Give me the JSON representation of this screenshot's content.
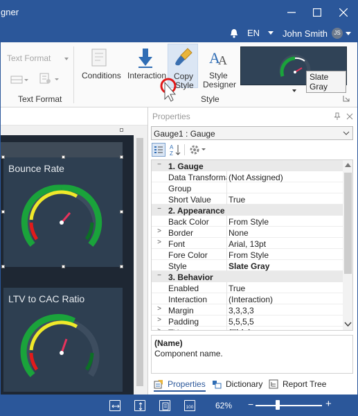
{
  "window": {
    "title": "gner",
    "controls": {
      "minimize": "minimize-icon",
      "maximize": "maximize-icon",
      "close": "close-icon"
    }
  },
  "userbar": {
    "language": "EN",
    "user_name": "John Smith",
    "user_initials": "JS"
  },
  "ribbon": {
    "text_format_dropdown": "Text Format",
    "text_format_group": "Text Format",
    "conditions_label": "Conditions",
    "interaction_label": "Interaction",
    "copy_style_label_1": "Copy",
    "copy_style_label_2": "Style",
    "style_designer_label_1": "Style",
    "style_designer_label_2": "Designer",
    "style_group": "Style",
    "style_preview_name": "Slate Gray",
    "colors": {
      "accent": "#2b579a",
      "preview_bg": "#304357"
    }
  },
  "canvas": {
    "panels": [
      {
        "title": "Bounce Rate"
      },
      {
        "title": "LTV to CAC Ratio"
      }
    ],
    "gauge_colors": {
      "green": "#1aa33b",
      "yellow": "#f0e92a",
      "red": "#e11b1b",
      "needle": "#e8335c",
      "track": "#3d4d5f"
    }
  },
  "properties": {
    "title": "Properties",
    "selected_component": "Gauge1 : Gauge",
    "rows": [
      {
        "kind": "cat",
        "expand": "−",
        "name": "1. Gauge"
      },
      {
        "kind": "prop",
        "expand": "",
        "name": "Data Transformat",
        "value": "(Not Assigned)"
      },
      {
        "kind": "prop",
        "expand": "",
        "name": "Group",
        "value": ""
      },
      {
        "kind": "prop",
        "expand": "",
        "name": "Short Value",
        "value": "True"
      },
      {
        "kind": "cat",
        "expand": "−",
        "name": "2. Appearance"
      },
      {
        "kind": "prop",
        "expand": "",
        "name": "Back Color",
        "value": "From Style"
      },
      {
        "kind": "prop",
        "expand": ">",
        "name": "Border",
        "value": "None"
      },
      {
        "kind": "prop",
        "expand": ">",
        "name": "Font",
        "value": "Arial, 13pt"
      },
      {
        "kind": "prop",
        "expand": "",
        "name": "Fore Color",
        "value": "From Style"
      },
      {
        "kind": "prop",
        "expand": "",
        "name": "Style",
        "value": "Slate Gray",
        "bold": true
      },
      {
        "kind": "cat",
        "expand": "−",
        "name": "3. Behavior"
      },
      {
        "kind": "prop",
        "expand": "",
        "name": "Enabled",
        "value": "True"
      },
      {
        "kind": "prop",
        "expand": "",
        "name": "Interaction",
        "value": "(Interaction)"
      },
      {
        "kind": "prop",
        "expand": ">",
        "name": "Margin",
        "value": "3,3,3,3"
      },
      {
        "kind": "prop",
        "expand": ">",
        "name": "Padding",
        "value": "5,5,5,5"
      },
      {
        "kind": "prop",
        "expand": ">",
        "name": "Title",
        "value": "(Title)",
        "bold": true
      }
    ],
    "description_title": "(Name)",
    "description_text": "Component name.",
    "tabs": [
      "Properties",
      "Dictionary",
      "Report Tree"
    ]
  },
  "statusbar": {
    "zoom": "62%",
    "zoom_level_fraction": 0.33,
    "icons": [
      "fit-width-icon",
      "fit-height-icon",
      "page-view-icon",
      "zoom-100-icon"
    ]
  }
}
